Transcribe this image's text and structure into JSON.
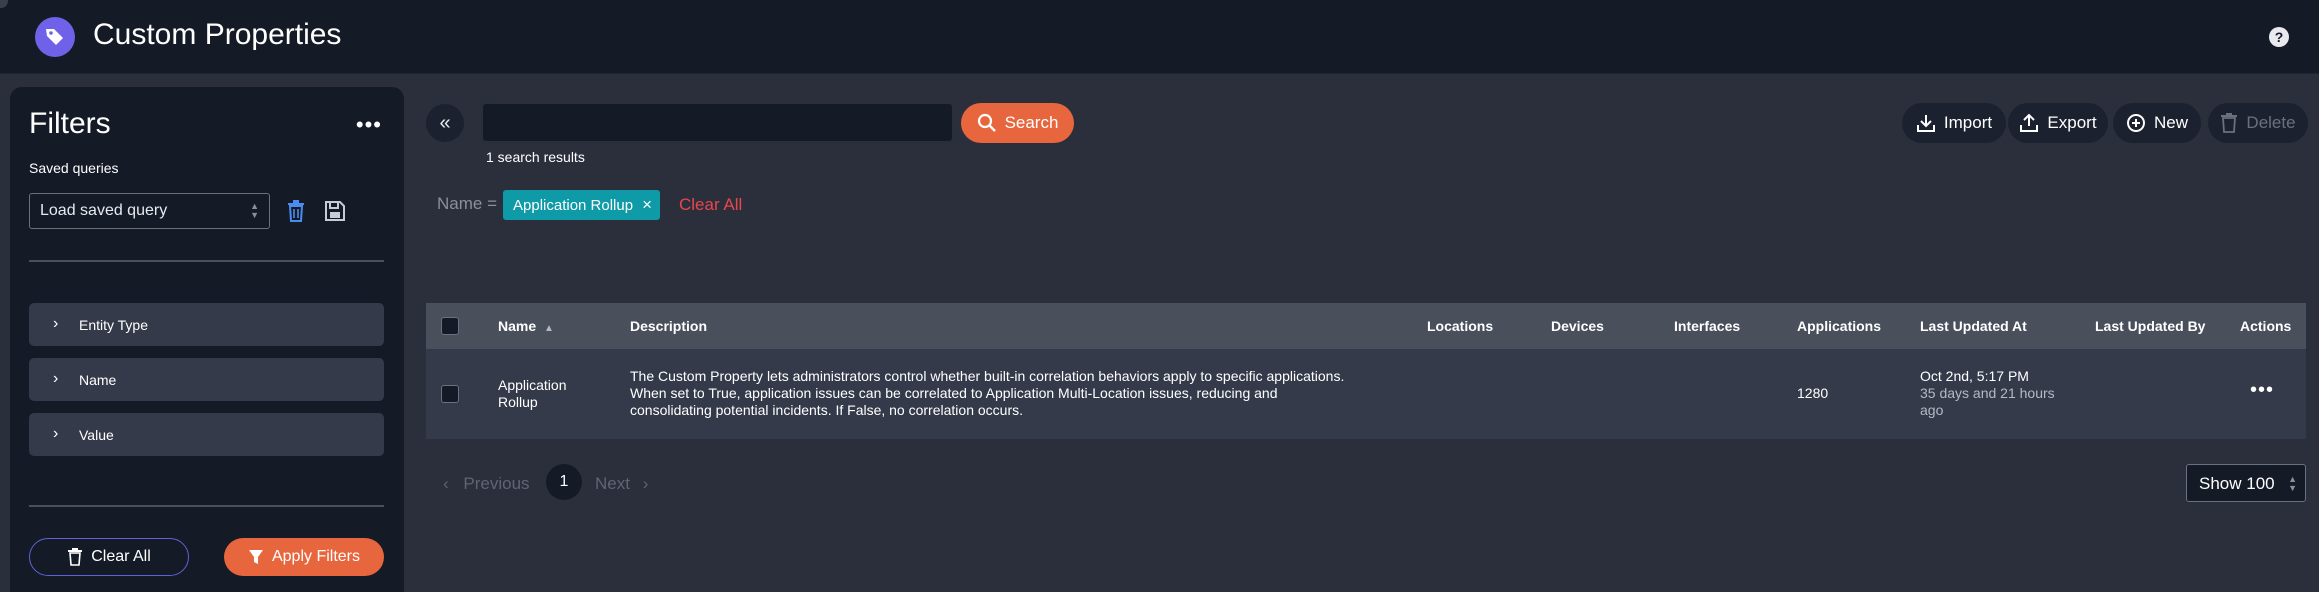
{
  "header": {
    "app_title": "Custom Properties",
    "help_glyph": "?",
    "logo_icon": "tag-icon",
    "logo_color": "#6f62e8"
  },
  "sidebar": {
    "title": "Filters",
    "more_glyph": "•••",
    "saved_queries_label": "Saved queries",
    "saved_query_select_value": "Load saved query",
    "filter_sections": [
      {
        "label": "Entity Type"
      },
      {
        "label": "Name"
      },
      {
        "label": "Value"
      }
    ],
    "clear_all_label": "Clear All",
    "apply_filters_label": "Apply Filters"
  },
  "search": {
    "input_value": "",
    "button_label": "Search",
    "results_text": "1 search results"
  },
  "toolbar": {
    "import_label": "Import",
    "export_label": "Export",
    "new_label": "New",
    "delete_label": "Delete"
  },
  "active_filters": {
    "field_label": "Name =",
    "chip_label": "Application Rollup",
    "clear_all_label": "Clear All"
  },
  "table": {
    "columns": [
      "Name",
      "Description",
      "Locations",
      "Devices",
      "Interfaces",
      "Applications",
      "Last Updated At",
      "Last Updated By",
      "Actions"
    ],
    "rows": [
      {
        "name_line1": "Application",
        "name_line2": "Rollup",
        "description_line1": "The Custom Property lets administrators control whether built-in correlation behaviors apply to specific applications.",
        "description_line2": "When set to True, application issues can be correlated to Application Multi-Location issues, reducing and",
        "description_line3": "consolidating potential incidents. If False, no correlation occurs.",
        "locations": "",
        "devices": "",
        "interfaces": "",
        "applications": "1280",
        "updated_at": "Oct 2nd, 5:17 PM",
        "updated_relative_line1": "35 days and 21 hours",
        "updated_relative_line2": "ago",
        "updated_by": "",
        "actions_glyph": "•••"
      }
    ]
  },
  "pagination": {
    "previous_label": "Previous",
    "current_page": "1",
    "next_label": "Next",
    "page_size_label": "Show 100"
  },
  "colors": {
    "accent_orange": "#e8663d",
    "chip_teal": "#0e9aa7",
    "danger_red": "#e8464d"
  }
}
